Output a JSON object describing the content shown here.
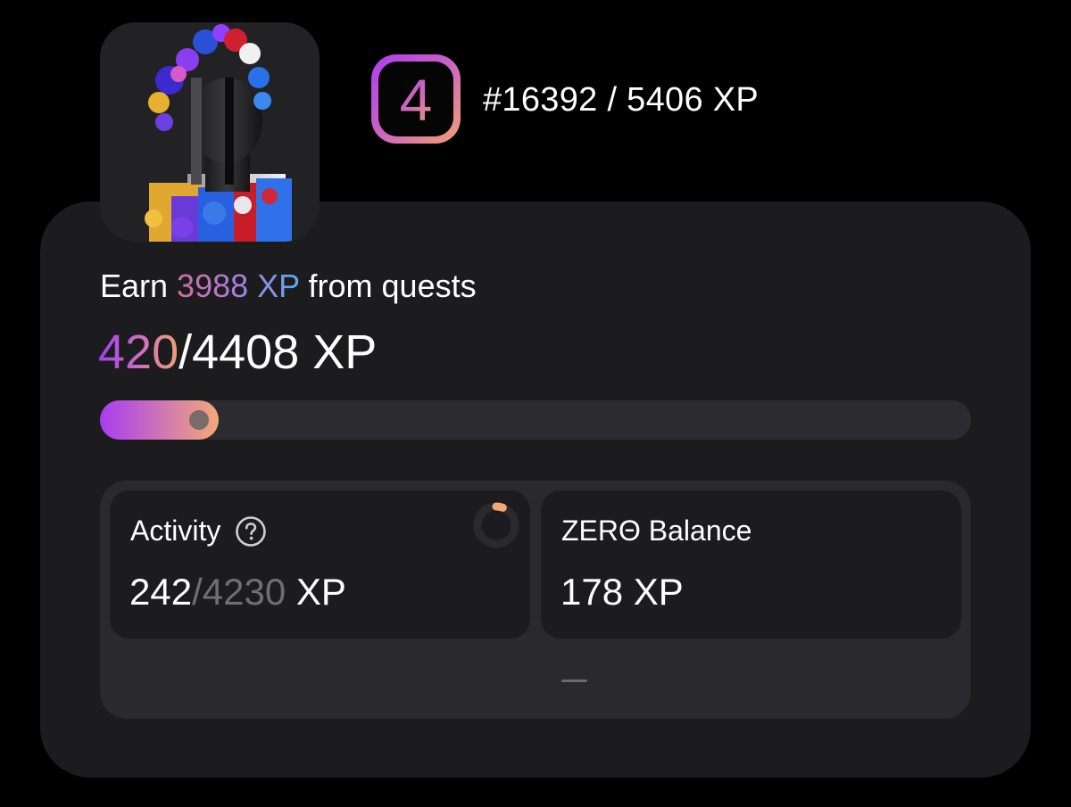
{
  "profile": {
    "level": "4",
    "rank_text": "#16392 / 5406 XP"
  },
  "quests": {
    "earn_prefix": "Earn ",
    "earn_amount": "3988 XP",
    "earn_suffix": " from quests",
    "progress_current": "420",
    "progress_total": "/4408 XP",
    "progress_fraction": 0.095
  },
  "stats": {
    "activity": {
      "label": "Activity",
      "value": "242",
      "total": "/4230",
      "unit": " XP",
      "ring_fraction": 0.057
    },
    "balance": {
      "label": "ZERΘ Balance",
      "value": "178 XP"
    }
  },
  "colors": {
    "background": "#000000",
    "card": "#1c1c1e",
    "panel": "#2a2a2e",
    "accent_purple": "#a83cf0",
    "accent_peach": "#f4a878",
    "accent_blue": "#5aa8f0"
  },
  "icons": {
    "help": "question-circle-icon",
    "ring": "activity-progress-ring-icon"
  }
}
